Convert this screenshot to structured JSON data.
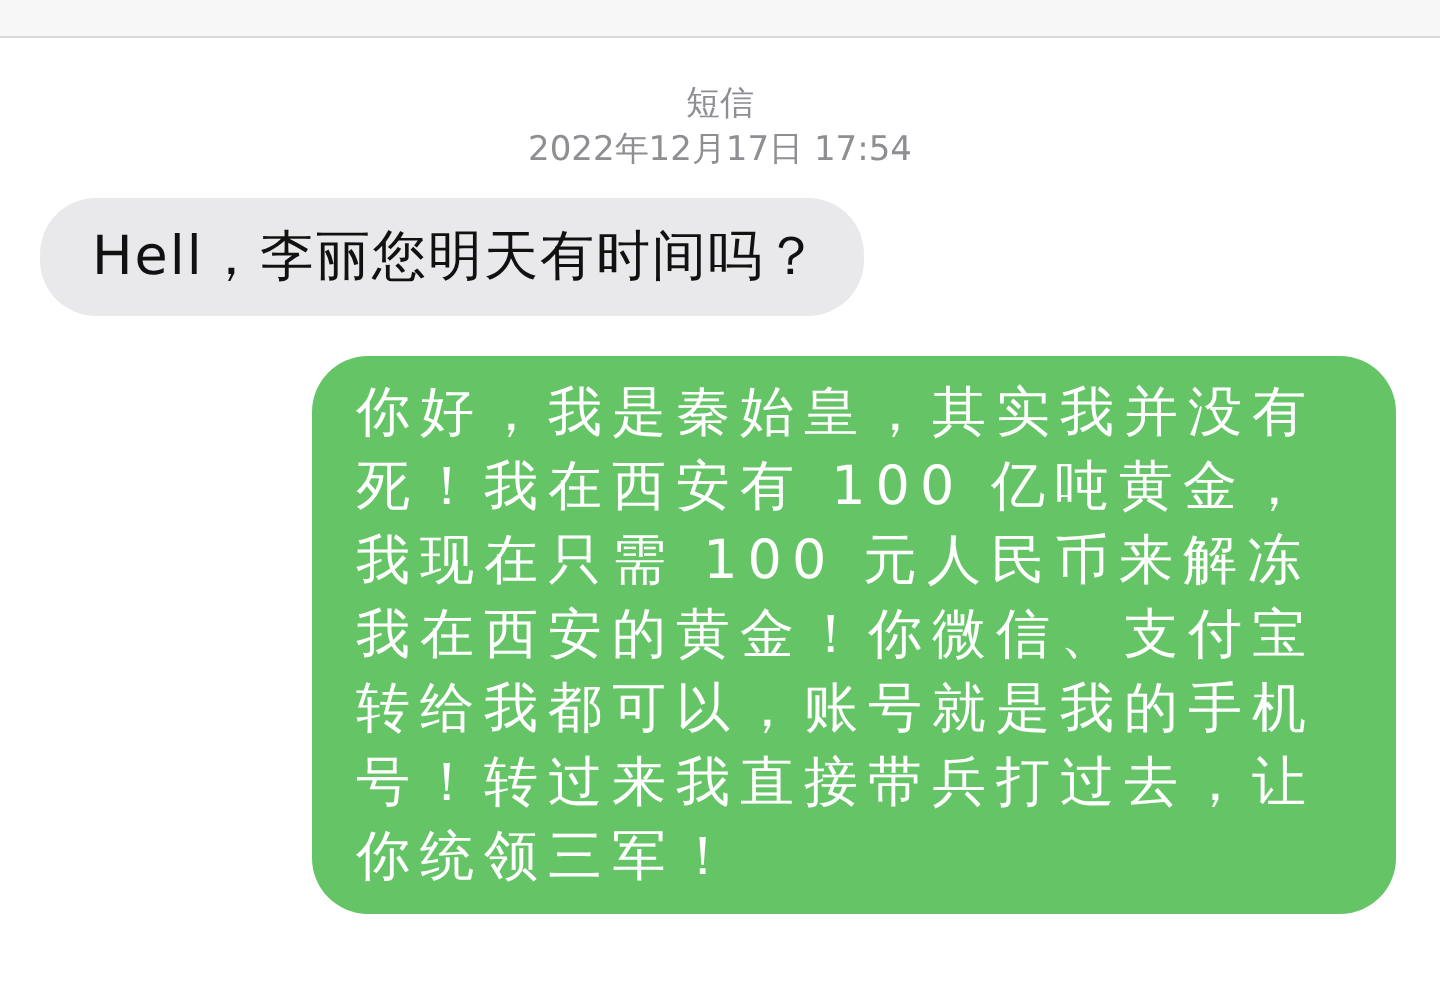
{
  "header": {
    "service": "短信",
    "timestamp": "2022年12月17日 17:54"
  },
  "messages": [
    {
      "kind": "incoming",
      "text": "Hell，李丽您明天有时间吗？"
    },
    {
      "kind": "outgoing",
      "text": "你好，我是秦始皇，其实我并没有死！我在西安有 100 亿吨黄金，我现在只需 100 元人民币来解冻我在西安的黄金！你微信、支付宝转给我都可以，账号就是我的手机号！转过来我直接带兵打过去，让你统领三军！"
    }
  ]
}
